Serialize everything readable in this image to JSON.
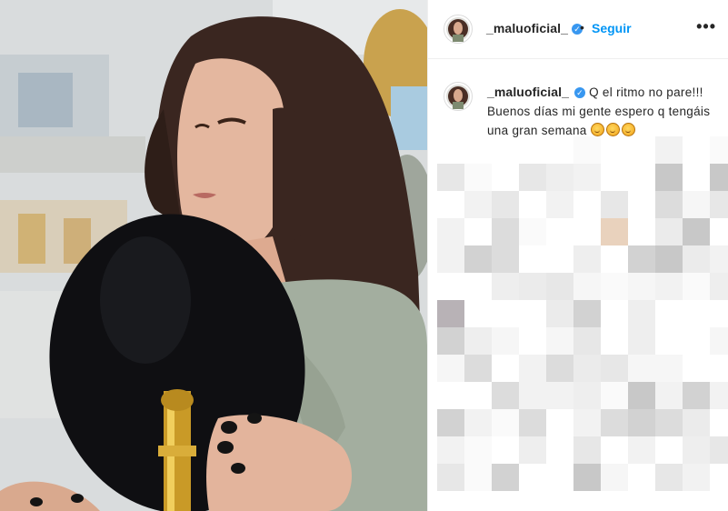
{
  "post": {
    "username": "_maluoficial_",
    "follow_label": "Seguir",
    "separator": "•",
    "more_label": "•••",
    "verified_glyph": "✓",
    "caption_line1": "Q el ritmo no pare!!!",
    "caption_line2": "Buenos días mi gente espero q tengáis una gran semana",
    "emoji_count": 3
  },
  "colors": {
    "follow_blue": "#0095f6",
    "verified_blue": "#3897f0",
    "text": "#262626",
    "border": "#efefef"
  },
  "icons": [
    "avatar",
    "verified-badge-icon",
    "more-options-icon",
    "emoji-icon"
  ],
  "photo": {
    "subject": "woman holding round black mirror"
  }
}
